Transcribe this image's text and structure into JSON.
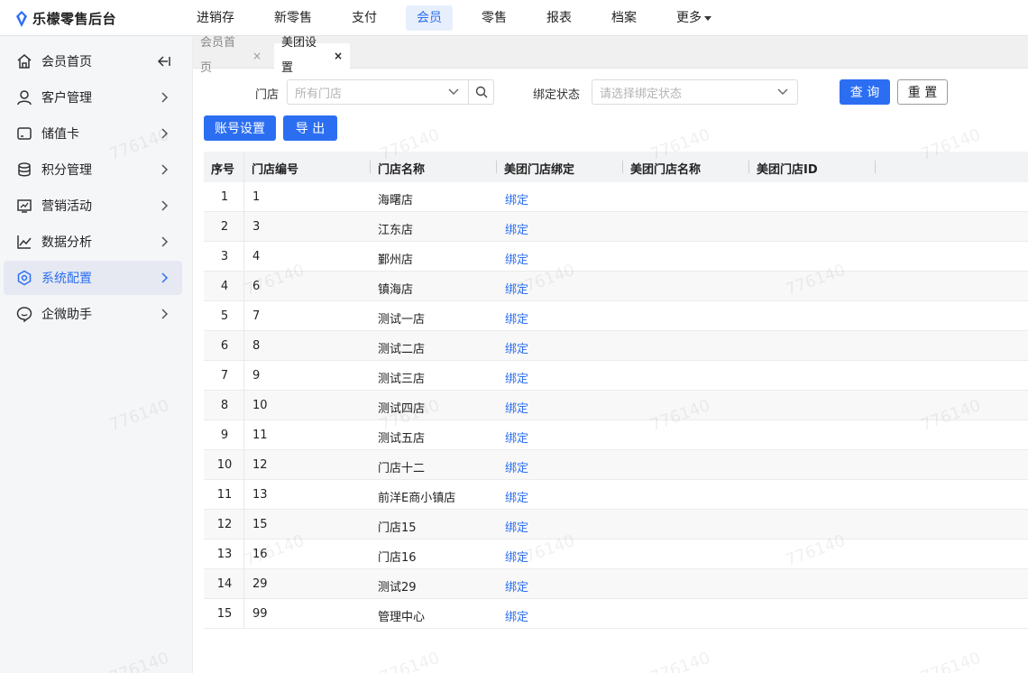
{
  "app": {
    "title": "乐檬零售后台",
    "brand_color": "#2b6ef2"
  },
  "topnav": [
    {
      "label": "进销存",
      "active": false
    },
    {
      "label": "新零售",
      "active": false
    },
    {
      "label": "支付",
      "active": false
    },
    {
      "label": "会员",
      "active": true
    },
    {
      "label": "零售",
      "active": false
    },
    {
      "label": "报表",
      "active": false
    },
    {
      "label": "档案",
      "active": false
    },
    {
      "label": "更多",
      "active": false,
      "dropdown": true
    }
  ],
  "sidebar": {
    "items": [
      {
        "label": "会员首页",
        "icon": "home-icon",
        "trailing": "collapse-icon"
      },
      {
        "label": "客户管理",
        "icon": "user-icon",
        "trailing": "chevron-right-icon"
      },
      {
        "label": "储值卡",
        "icon": "card-icon",
        "trailing": "chevron-right-icon"
      },
      {
        "label": "积分管理",
        "icon": "coins-icon",
        "trailing": "chevron-right-icon"
      },
      {
        "label": "营销活动",
        "icon": "monitor-chart-icon",
        "trailing": "chevron-right-icon"
      },
      {
        "label": "数据分析",
        "icon": "line-chart-icon",
        "trailing": "chevron-right-icon"
      },
      {
        "label": "系统配置",
        "icon": "settings-hex-icon",
        "trailing": "chevron-right-icon",
        "active": true
      },
      {
        "label": "企微助手",
        "icon": "chat-bubble-icon",
        "trailing": "chevron-right-icon"
      }
    ]
  },
  "tabs": [
    {
      "label": "会员首页",
      "close": "×",
      "active": false
    },
    {
      "label": "美团设置",
      "close": "×",
      "active": true
    }
  ],
  "filters": {
    "store_label": "门店",
    "store_placeholder": "所有门店",
    "bind_label": "绑定状态",
    "bind_placeholder": "请选择绑定状态",
    "query_button": "查 询",
    "reset_button": "重 置"
  },
  "actions": {
    "account_settings": "账号设置",
    "export": "导 出"
  },
  "table": {
    "columns": [
      "序号",
      "门店编号",
      "门店名称",
      "美团门店绑定",
      "美团门店名称",
      "美团门店ID"
    ],
    "rows": [
      {
        "idx": "1",
        "code": "1",
        "name": "海曙店",
        "bind": "绑定"
      },
      {
        "idx": "2",
        "code": "3",
        "name": "江东店",
        "bind": "绑定"
      },
      {
        "idx": "3",
        "code": "4",
        "name": "鄞州店",
        "bind": "绑定"
      },
      {
        "idx": "4",
        "code": "6",
        "name": "镇海店",
        "bind": "绑定"
      },
      {
        "idx": "5",
        "code": "7",
        "name": "测试一店",
        "bind": "绑定"
      },
      {
        "idx": "6",
        "code": "8",
        "name": "测试二店",
        "bind": "绑定"
      },
      {
        "idx": "7",
        "code": "9",
        "name": "测试三店",
        "bind": "绑定"
      },
      {
        "idx": "8",
        "code": "10",
        "name": "测试四店",
        "bind": "绑定"
      },
      {
        "idx": "9",
        "code": "11",
        "name": "测试五店",
        "bind": "绑定"
      },
      {
        "idx": "10",
        "code": "12",
        "name": "门店十二",
        "bind": "绑定"
      },
      {
        "idx": "11",
        "code": "13",
        "name": "前洋E商小镇店",
        "bind": "绑定"
      },
      {
        "idx": "12",
        "code": "15",
        "name": "门店15",
        "bind": "绑定"
      },
      {
        "idx": "13",
        "code": "16",
        "name": "门店16",
        "bind": "绑定"
      },
      {
        "idx": "14",
        "code": "29",
        "name": "测试29",
        "bind": "绑定"
      },
      {
        "idx": "15",
        "code": "99",
        "name": "管理中心",
        "bind": "绑定"
      }
    ]
  },
  "watermark": "776140"
}
